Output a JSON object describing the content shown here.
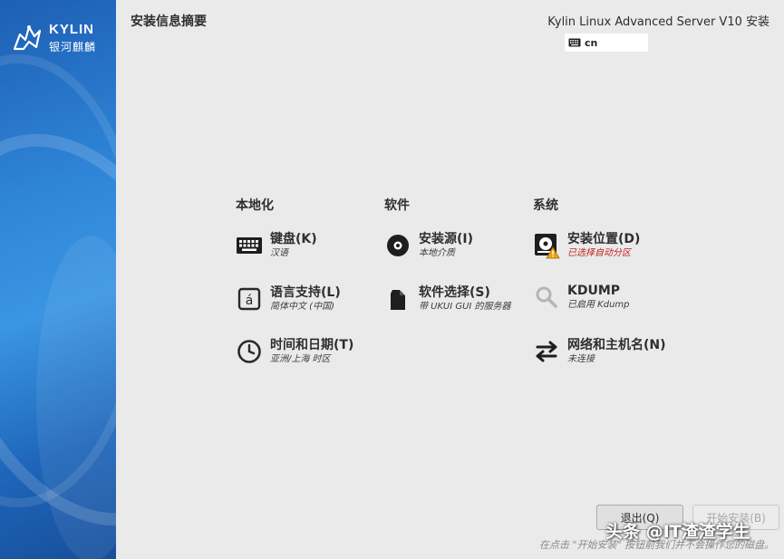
{
  "sidebar": {
    "logo_word": "KYLIN",
    "logo_cn": "银河麒麟"
  },
  "header": {
    "page_title": "安装信息摘要",
    "product_title": "Kylin Linux Advanced Server V10 安装",
    "keyboard_layout": "cn"
  },
  "categories": {
    "localization": "本地化",
    "software": "软件",
    "system": "系统"
  },
  "spokes": {
    "keyboard": {
      "label": "键盘(K)",
      "status": "汉语",
      "icon": "keyboard-icon"
    },
    "language": {
      "label": "语言支持(L)",
      "status": "简体中文 (中国)",
      "icon": "language-icon"
    },
    "datetime": {
      "label": "时间和日期(T)",
      "status": "亚洲/上海 时区",
      "icon": "clock-icon"
    },
    "source": {
      "label": "安装源(I)",
      "status": "本地介质",
      "icon": "disc-icon"
    },
    "software_selection": {
      "label": "软件选择(S)",
      "status": "带 UKUI GUI 的服务器",
      "icon": "package-icon"
    },
    "install_dest": {
      "label": "安装位置(D)",
      "status": "已选择自动分区",
      "icon": "disk-warning-icon"
    },
    "kdump": {
      "label": "KDUMP",
      "status": "已启用 Kdump",
      "icon": "search-icon"
    },
    "network": {
      "label": "网络和主机名(N)",
      "status": "未连接",
      "icon": "network-arrows-icon"
    }
  },
  "footer": {
    "quit_label": "退出(Q)",
    "begin_label": "开始安装(B)",
    "hint": "在点击 \"开始安装\" 按钮前我们并不会操作您的磁盘。",
    "watermark": "头条 @IT渣渣学生"
  },
  "colors": {
    "sidebar_blue": "#2f86d8",
    "warning_red": "#c4201f",
    "background": "#eaeaea"
  }
}
